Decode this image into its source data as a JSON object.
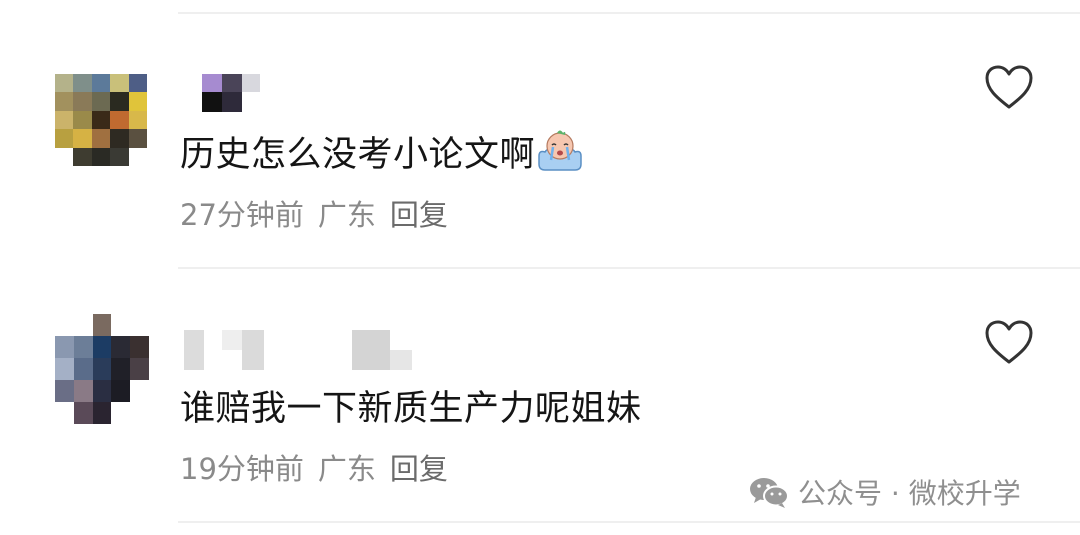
{
  "comments": [
    {
      "text": "历史怎么没考小论文啊",
      "time": "27分钟前",
      "location": "广东",
      "reply_label": "回复",
      "emoji_name": "crying-emoji"
    },
    {
      "text": "谁赔我一下新质生产力呢姐妹",
      "time": "19分钟前",
      "location": "广东",
      "reply_label": "回复"
    }
  ],
  "watermark": {
    "label": "公众号 · 微校升学",
    "icon": "wechat-icon"
  },
  "colors": {
    "text": "#151515",
    "meta": "#8a8a8a",
    "divider": "#efefef",
    "heart_outline": "#333333"
  }
}
